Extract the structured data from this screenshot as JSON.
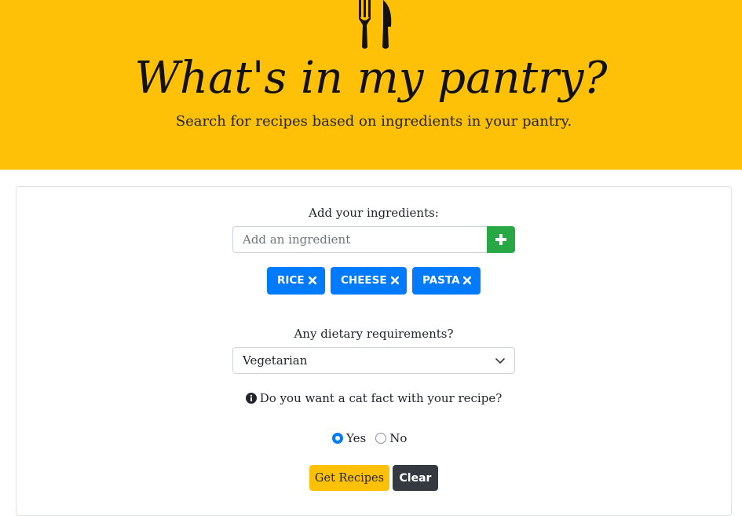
{
  "hero": {
    "title": "What's in my pantry?",
    "subtitle": "Search for recipes based on ingredients in your pantry.",
    "logo_icon": "fork-knife-icon",
    "background_color": "#ffc107"
  },
  "ingredients": {
    "label": "Add your ingredients:",
    "input_placeholder": "Add an ingredient",
    "input_value": "",
    "add_icon": "plus-icon",
    "add_button_color": "#28a745",
    "chip_color": "#007bff",
    "remove_icon": "close-icon",
    "items": [
      {
        "label": "RICE"
      },
      {
        "label": "CHEESE"
      },
      {
        "label": "PASTA"
      }
    ]
  },
  "dietary": {
    "label": "Any dietary requirements?",
    "selected": "Vegetarian",
    "chevron_icon": "chevron-down-icon"
  },
  "cat_fact": {
    "question": "Do you want a cat fact with your recipe?",
    "info_icon": "info-circle-icon",
    "options": [
      {
        "label": "Yes",
        "checked": true
      },
      {
        "label": "No",
        "checked": false
      }
    ]
  },
  "actions": {
    "get_recipes_label": "Get Recipes",
    "clear_label": "Clear"
  }
}
